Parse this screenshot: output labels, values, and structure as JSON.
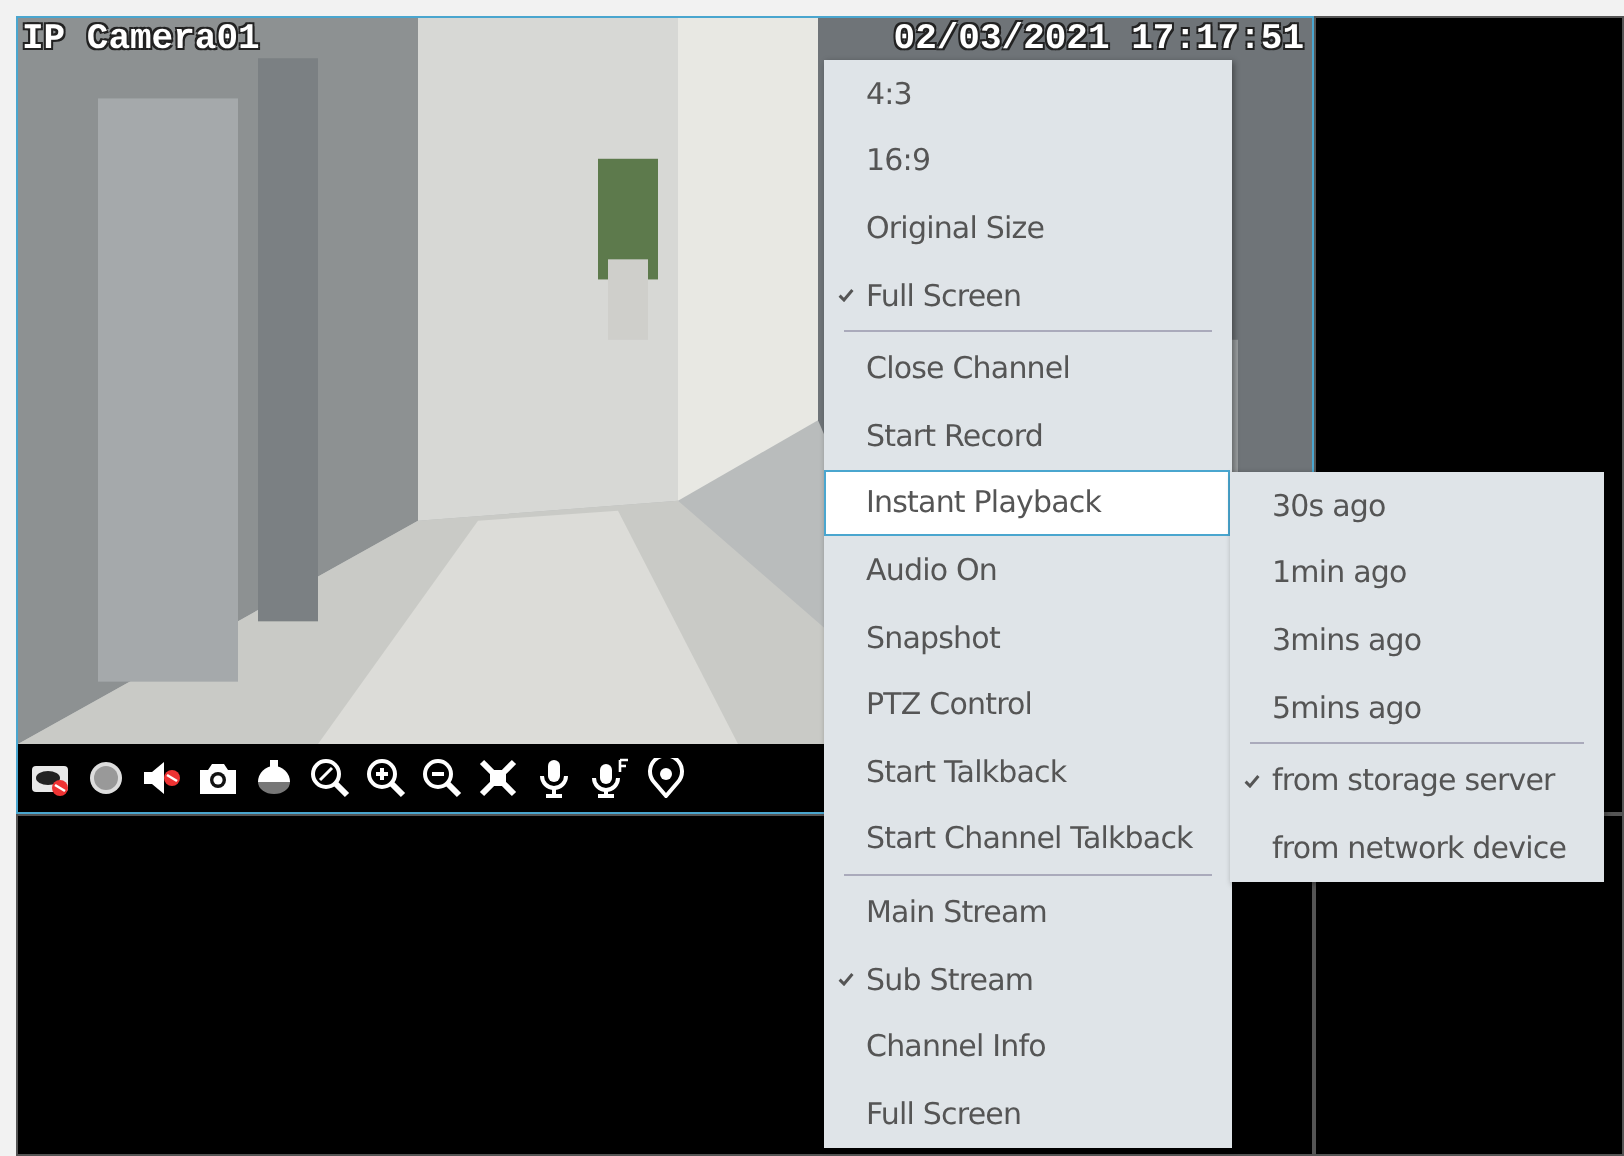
{
  "video_tile": {
    "camera_name": "IP Camera01",
    "timestamp": "02/03/2021 17:17:51",
    "selected": true
  },
  "context_menu": {
    "items": [
      {
        "kind": "item",
        "label": "4:3",
        "checked": false,
        "selected": false
      },
      {
        "kind": "item",
        "label": "16:9",
        "checked": false,
        "selected": false
      },
      {
        "kind": "item",
        "label": "Original Size",
        "checked": false,
        "selected": false
      },
      {
        "kind": "item",
        "label": "Full Screen",
        "checked": true,
        "selected": false
      },
      {
        "kind": "separator"
      },
      {
        "kind": "item",
        "label": "Close Channel",
        "checked": false,
        "selected": false
      },
      {
        "kind": "item",
        "label": "Start Record",
        "checked": false,
        "selected": false
      },
      {
        "kind": "item",
        "label": "Instant Playback",
        "checked": false,
        "selected": true
      },
      {
        "kind": "item",
        "label": "Audio On",
        "checked": false,
        "selected": false
      },
      {
        "kind": "item",
        "label": "Snapshot",
        "checked": false,
        "selected": false
      },
      {
        "kind": "item",
        "label": "PTZ Control",
        "checked": false,
        "selected": false
      },
      {
        "kind": "item",
        "label": "Start Talkback",
        "checked": false,
        "selected": false
      },
      {
        "kind": "item",
        "label": "Start Channel Talkback",
        "checked": false,
        "selected": false
      },
      {
        "kind": "separator"
      },
      {
        "kind": "item",
        "label": "Main Stream",
        "checked": false,
        "selected": false
      },
      {
        "kind": "item",
        "label": "Sub Stream",
        "checked": true,
        "selected": false
      },
      {
        "kind": "item",
        "label": "Channel Info",
        "checked": false,
        "selected": false
      },
      {
        "kind": "item",
        "label": "Full Screen",
        "checked": false,
        "selected": false
      }
    ]
  },
  "submenu": {
    "items": [
      {
        "kind": "item",
        "label": "30s ago",
        "checked": false,
        "selected": false
      },
      {
        "kind": "item",
        "label": "1min ago",
        "checked": false,
        "selected": false
      },
      {
        "kind": "item",
        "label": "3mins ago",
        "checked": false,
        "selected": false
      },
      {
        "kind": "item",
        "label": "5mins ago",
        "checked": false,
        "selected": false
      },
      {
        "kind": "separator"
      },
      {
        "kind": "item",
        "label": "from storage server",
        "checked": true,
        "selected": false
      },
      {
        "kind": "item",
        "label": "from network device",
        "checked": false,
        "selected": false
      }
    ]
  }
}
